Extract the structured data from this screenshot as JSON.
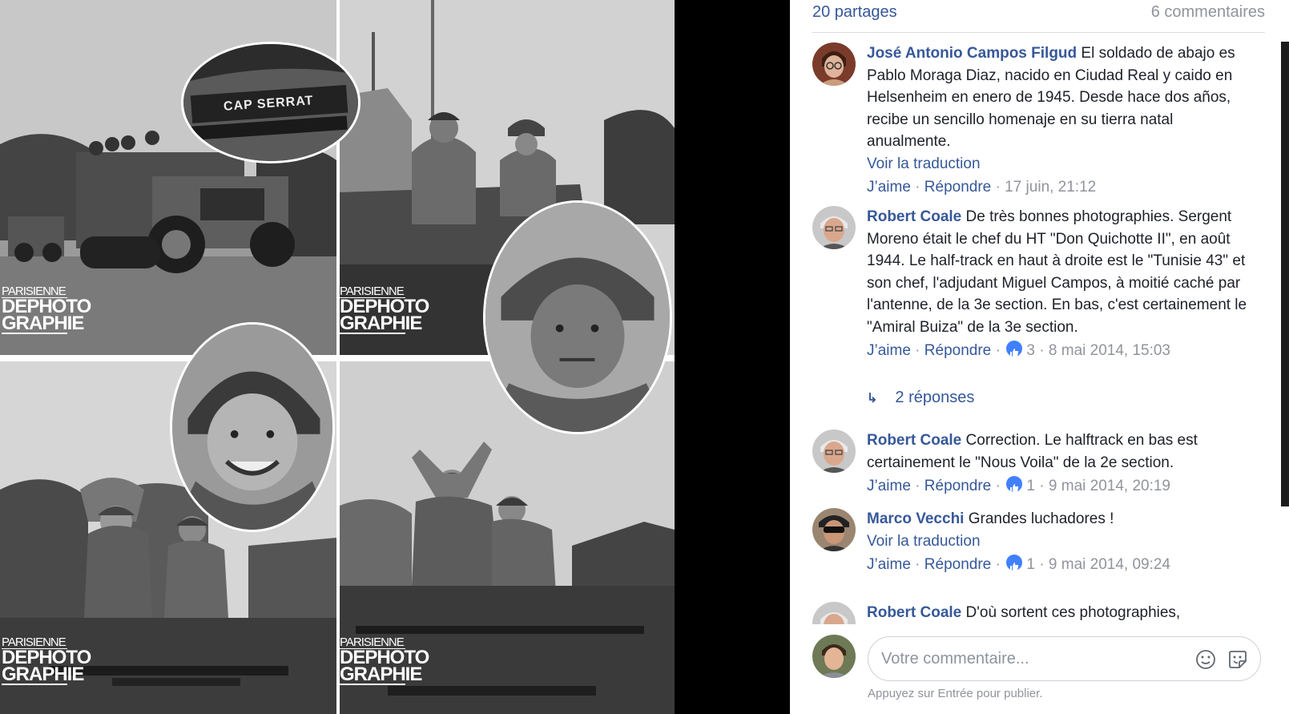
{
  "summary": {
    "shares": "20 partages",
    "comments": "6 commentaires"
  },
  "watermark": {
    "line1": "PARISIENNE",
    "line2": "DEPHOTO",
    "line3": "GRAPHIE"
  },
  "sign_text": "CAP SERRAT",
  "comments": [
    {
      "author": "José Antonio Campos Filgud",
      "text": "El soldado de abajo es Pablo Moraga Diaz, nacido en Ciudad Real y caido en Helsenheim en enero de 1945. Desde hace dos años, recibe un sencillo homenaje en su tierra natal anualmente.",
      "translate": "Voir la traduction",
      "like": "J’aime",
      "reply": "Répondre",
      "likes": "",
      "time": "17 juin, 21:12"
    },
    {
      "author": "Robert Coale",
      "text": "De très bonnes photographies. Sergent Moreno était le chef du HT \"Don Quichotte II\", en août 1944. Le half-track en haut à droite est le \"Tunisie 43\" et son chef, l'adjudant Miguel Campos, à moitié caché par l'antenne, de la 3e section. En bas, c'est certainement le \"Amiral Buiza\" de la 3e section.",
      "like": "J’aime",
      "reply": "Répondre",
      "likes": "3",
      "time": "8 mai 2014, 15:03",
      "replies": "2 réponses"
    },
    {
      "author": "Robert Coale",
      "text": "Correction. Le halftrack en bas est certainement le \"Nous Voila\" de la 2e section.",
      "like": "J’aime",
      "reply": "Répondre",
      "likes": "1",
      "time": "9 mai 2014, 20:19"
    },
    {
      "author": "Marco Vecchi",
      "text": "Grandes luchadores !",
      "translate": "Voir la traduction",
      "like": "J’aime",
      "reply": "Répondre",
      "likes": "1",
      "time": "9 mai 2014, 09:24"
    },
    {
      "author": "Robert Coale",
      "text": "D'où sortent ces photographies,"
    }
  ],
  "composer": {
    "placeholder": "Votre commentaire...",
    "hint": "Appuyez sur Entrée pour publier."
  },
  "colors": {
    "link": "#365899",
    "muted": "#90949c",
    "like_badge": "#4080ff"
  }
}
